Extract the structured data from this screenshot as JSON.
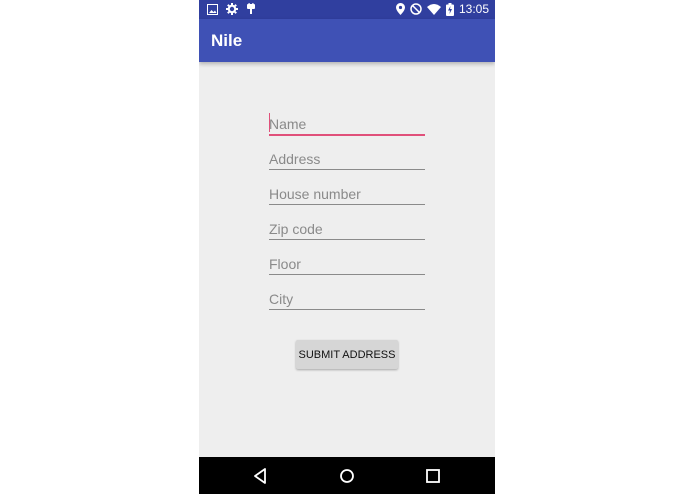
{
  "status_bar": {
    "time": "13:05",
    "left_icons": [
      "image-icon",
      "settings-icon",
      "usb-icon"
    ],
    "right_icons": [
      "location-icon",
      "do-not-disturb-icon",
      "wifi-icon",
      "battery-charging-icon"
    ]
  },
  "app_bar": {
    "title": "Nile"
  },
  "form": {
    "fields": [
      {
        "placeholder": "Name",
        "value": ""
      },
      {
        "placeholder": "Address",
        "value": ""
      },
      {
        "placeholder": "House number",
        "value": ""
      },
      {
        "placeholder": "Zip code",
        "value": ""
      },
      {
        "placeholder": "Floor",
        "value": ""
      },
      {
        "placeholder": "City",
        "value": ""
      }
    ],
    "submit_label": "SUBMIT ADDRESS"
  },
  "nav_bar": {
    "icons": [
      "back-icon",
      "home-icon",
      "recents-icon"
    ]
  },
  "colors": {
    "status_bar": "#303f9f",
    "app_bar": "#3f51b5",
    "accent": "#e0507a",
    "background": "#eeeeee"
  }
}
